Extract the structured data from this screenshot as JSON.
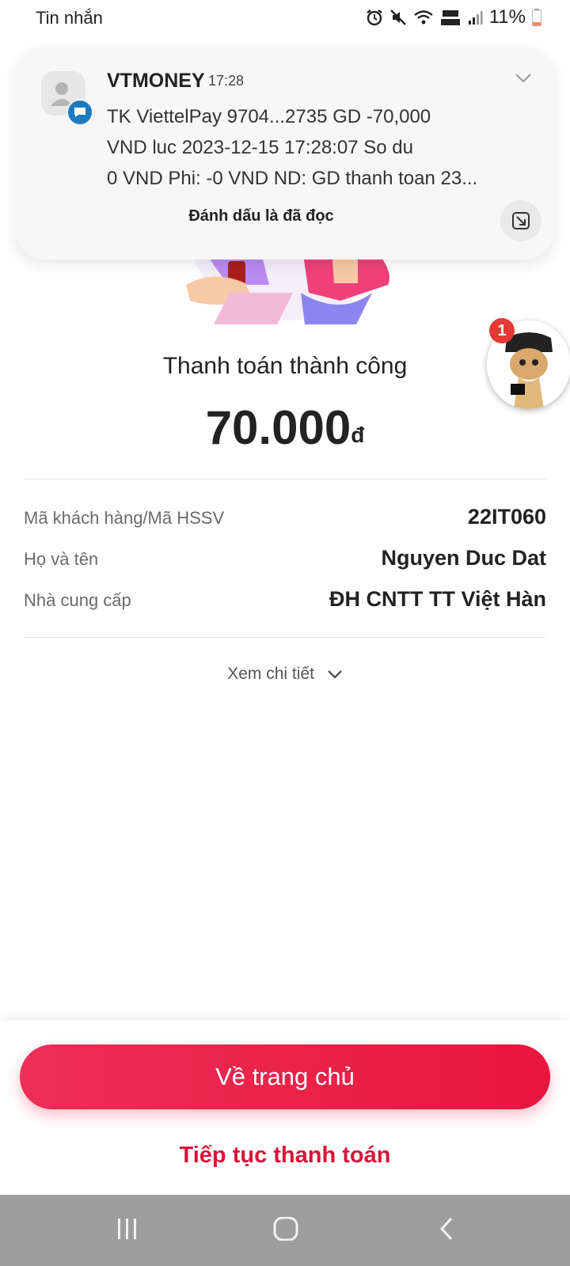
{
  "status_bar": {
    "title": "Tin nhắn",
    "battery": "11%"
  },
  "notification": {
    "sender": "VTMONEY",
    "time": "17:28",
    "lines": [
      "TK ViettelPay 9704...2735 GD -70,000",
      "VND luc 2023-12-15 17:28:07 So du",
      "0 VND Phi: -0 VND ND: GD thanh toan 23..."
    ],
    "mark_read": "Đánh dấu là đã đọc"
  },
  "chat_bubble": {
    "count": "1"
  },
  "payment": {
    "status": "Thanh toán thành công",
    "amount": "70.000",
    "currency": "đ",
    "details": [
      {
        "label": "Mã khách hàng/Mã HSSV",
        "value": "22IT060"
      },
      {
        "label": "Họ và tên",
        "value": "Nguyen Duc Dat"
      },
      {
        "label": "Nhà cung cấp",
        "value": "ĐH CNTT TT Việt Hàn"
      }
    ],
    "see_details": "Xem chi tiết"
  },
  "actions": {
    "home": "Về trang chủ",
    "continue": "Tiếp tục thanh toán"
  },
  "colors": {
    "accent": "#e8163e",
    "badge_blue": "#1e7bbf"
  }
}
